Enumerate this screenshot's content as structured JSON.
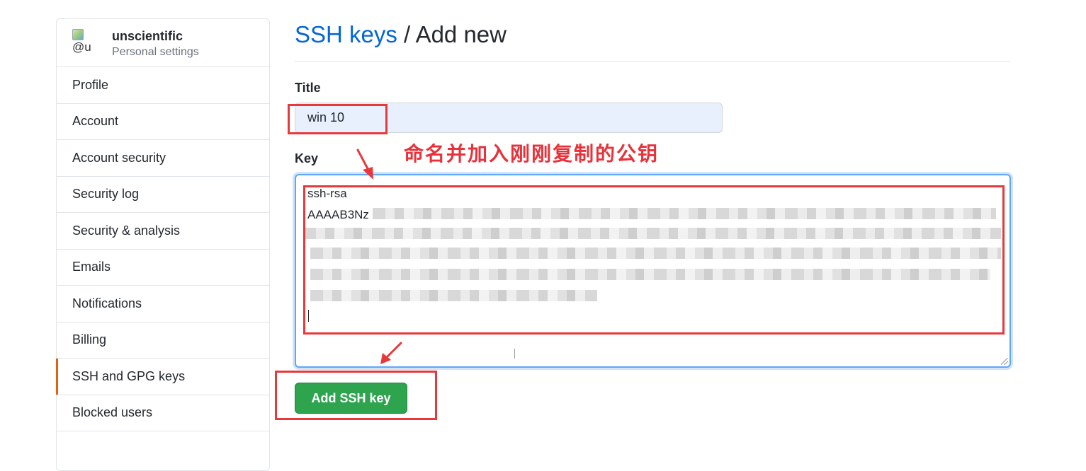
{
  "sidebar": {
    "username": "unscientific",
    "subtitle": "Personal settings",
    "avatar_alt": "@u",
    "items": [
      {
        "label": "Profile"
      },
      {
        "label": "Account"
      },
      {
        "label": "Account security"
      },
      {
        "label": "Security log"
      },
      {
        "label": "Security & analysis"
      },
      {
        "label": "Emails"
      },
      {
        "label": "Notifications"
      },
      {
        "label": "Billing"
      },
      {
        "label": "SSH and GPG keys",
        "selected": true
      },
      {
        "label": "Blocked users"
      }
    ]
  },
  "header": {
    "breadcrumb": "SSH keys",
    "separator": " / ",
    "title": "Add new"
  },
  "form": {
    "title_label": "Title",
    "title_value": "win 10",
    "key_label": "Key",
    "key_line1": "ssh-rsa",
    "key_line2_prefix": "AAAAB3Nz",
    "submit_label": "Add SSH key"
  },
  "annotation": {
    "note": "命名并加入刚刚复制的公钥",
    "color": "#e5393c"
  },
  "colors": {
    "link": "#0366d6",
    "button": "#2ea44f",
    "selected_marker": "#e36209"
  }
}
